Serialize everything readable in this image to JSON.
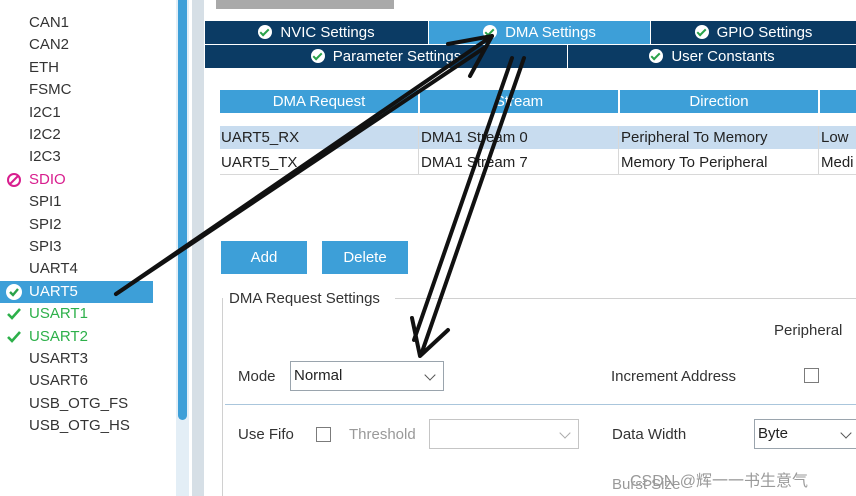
{
  "sidebar": {
    "items": [
      {
        "label": "CAN1",
        "state": "normal"
      },
      {
        "label": "CAN2",
        "state": "normal"
      },
      {
        "label": "ETH",
        "state": "normal"
      },
      {
        "label": "FSMC",
        "state": "normal"
      },
      {
        "label": "I2C1",
        "state": "normal"
      },
      {
        "label": "I2C2",
        "state": "normal"
      },
      {
        "label": "I2C3",
        "state": "normal"
      },
      {
        "label": "SDIO",
        "state": "error"
      },
      {
        "label": "SPI1",
        "state": "normal"
      },
      {
        "label": "SPI2",
        "state": "normal"
      },
      {
        "label": "SPI3",
        "state": "normal"
      },
      {
        "label": "UART4",
        "state": "normal"
      },
      {
        "label": "UART5",
        "state": "selected"
      },
      {
        "label": "USART1",
        "state": "enabled"
      },
      {
        "label": "USART2",
        "state": "enabled"
      },
      {
        "label": "USART3",
        "state": "normal"
      },
      {
        "label": "USART6",
        "state": "normal"
      },
      {
        "label": "USB_OTG_FS",
        "state": "normal"
      },
      {
        "label": "USB_OTG_HS",
        "state": "normal"
      }
    ]
  },
  "tabs": {
    "nvic": "NVIC Settings",
    "dma": "DMA Settings",
    "gpio": "GPIO Settings",
    "parameter": "Parameter Settings",
    "user_constants": "User Constants"
  },
  "dma_table": {
    "headers": [
      "DMA Request",
      "Stream",
      "Direction",
      ""
    ],
    "rows": [
      {
        "request": "UART5_RX",
        "stream": "DMA1 Stream 0",
        "direction": "Peripheral To Memory",
        "priority": "Low"
      },
      {
        "request": "UART5_TX",
        "stream": "DMA1 Stream 7",
        "direction": "Memory To Peripheral",
        "priority": "Medi"
      }
    ]
  },
  "buttons": {
    "add": "Add",
    "delete": "Delete"
  },
  "settings": {
    "group_title": "DMA Request Settings",
    "peripheral_header": "Peripheral",
    "mode_label": "Mode",
    "mode_value": "Normal",
    "increment_label": "Increment Address",
    "use_fifo_label": "Use Fifo",
    "threshold_label": "Threshold",
    "threshold_value": "",
    "data_width_label": "Data Width",
    "data_width_value": "Byte",
    "burst_size_label": "Burst Size"
  },
  "watermark": "CSDN @辉一一书生意气",
  "colors": {
    "accent": "#3d9fd8",
    "tab_dark": "#0b3b64",
    "enabled": "#2db04a",
    "error": "#d81e8e",
    "selected_row": "#c8dcef"
  }
}
